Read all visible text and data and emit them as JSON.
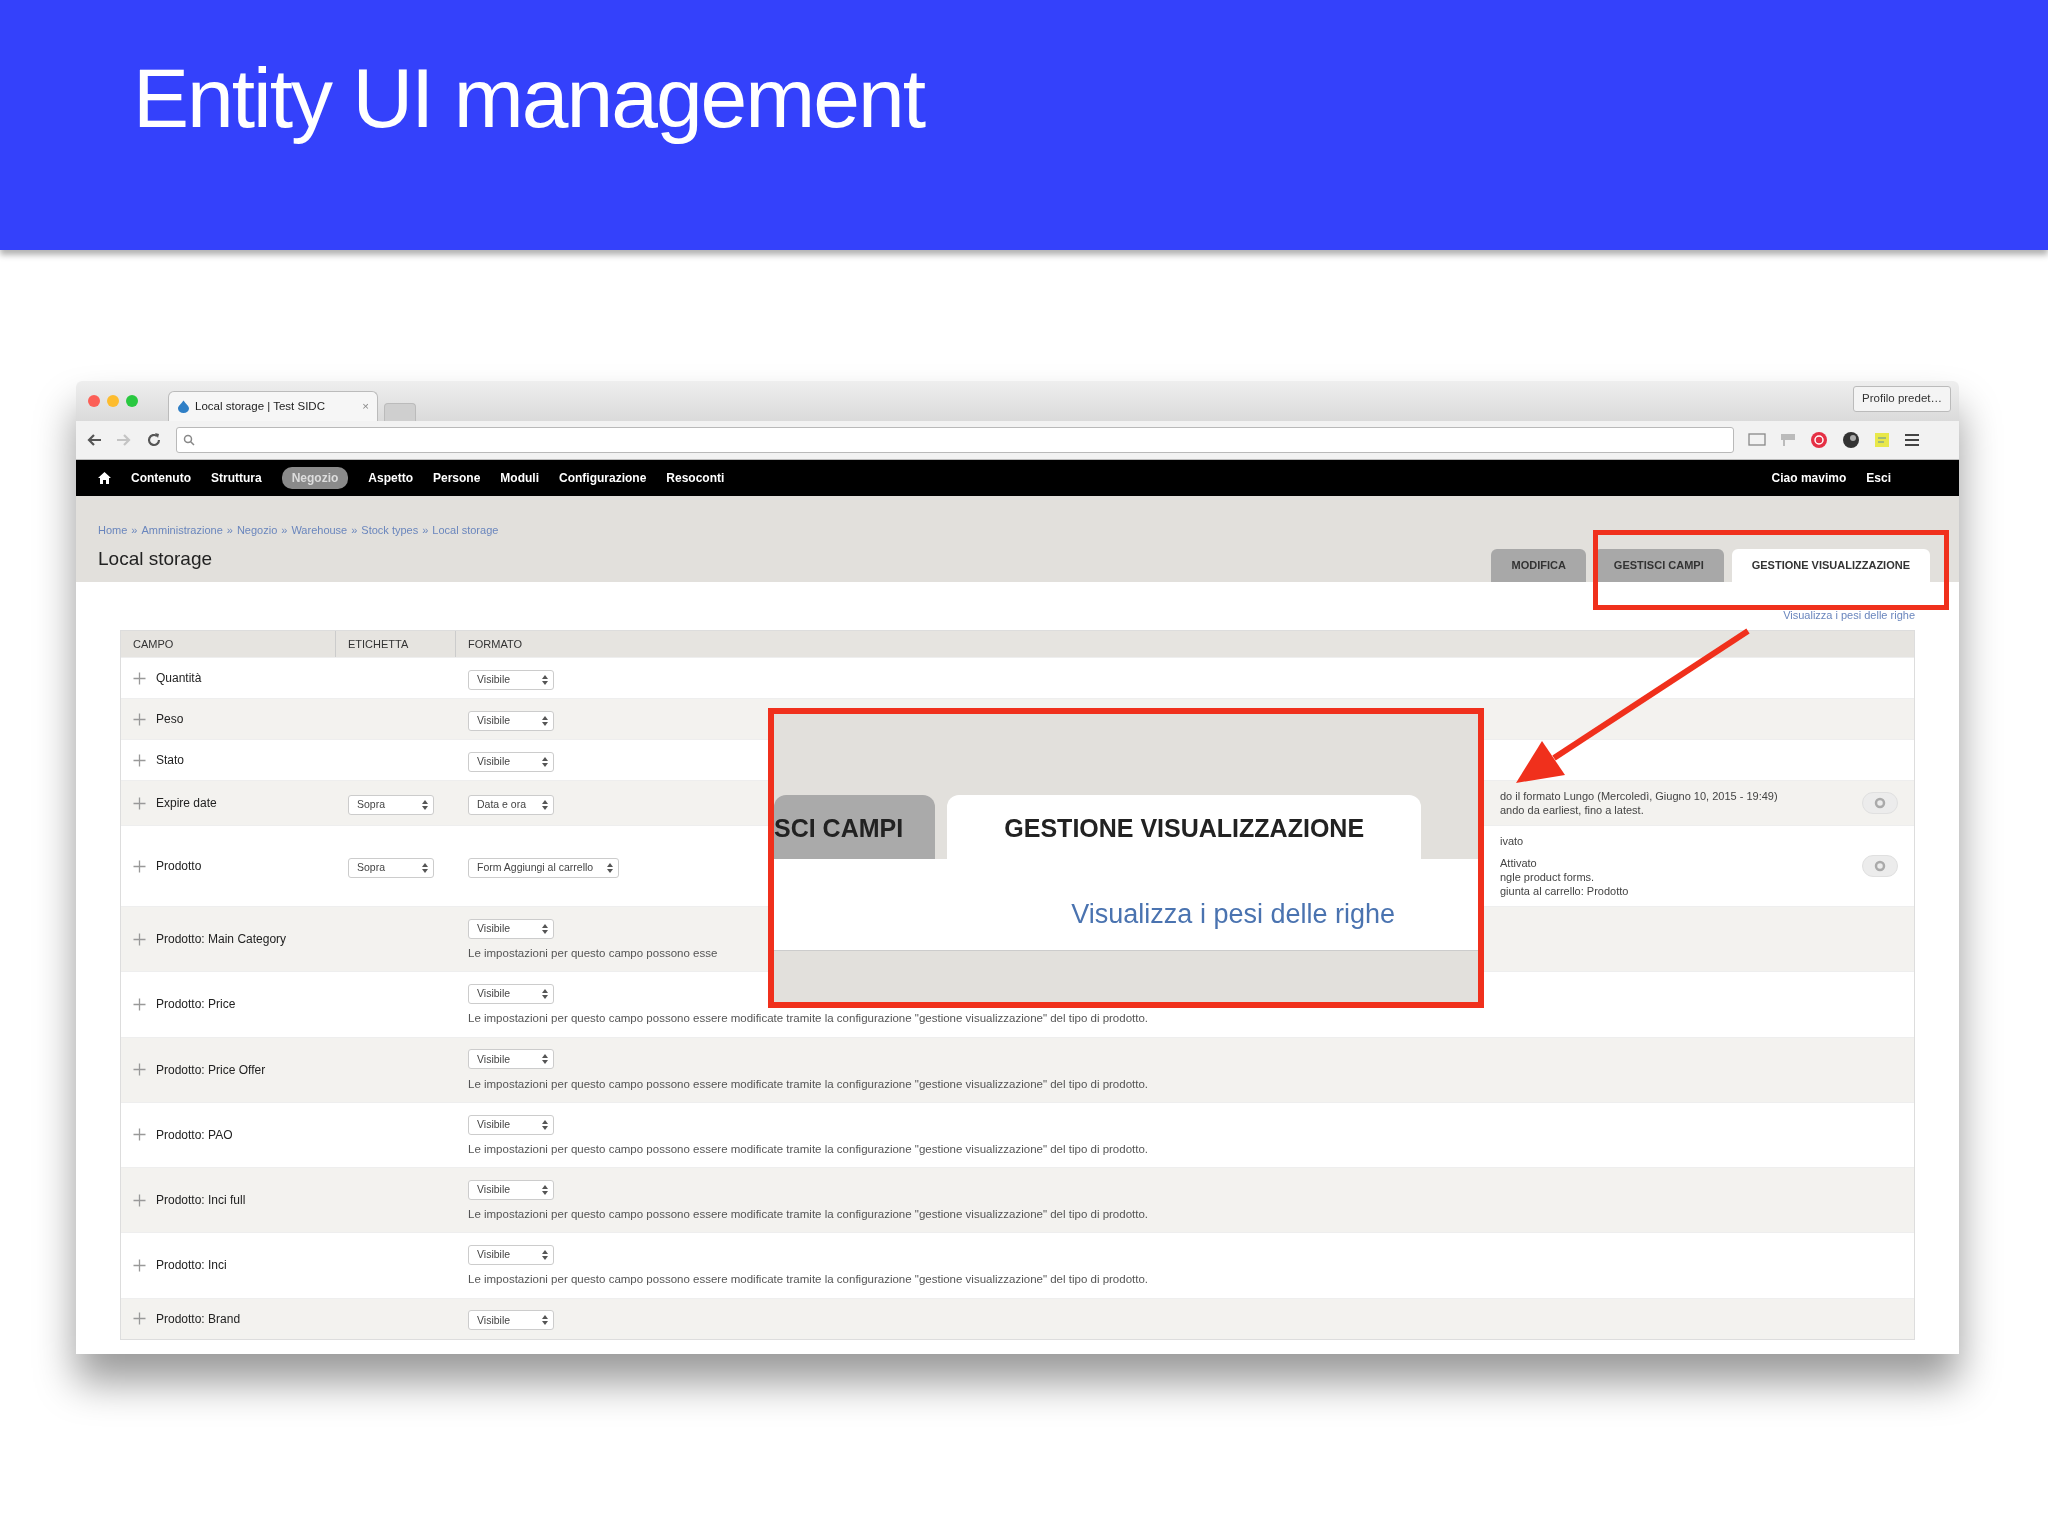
{
  "slide": {
    "title": "Entity UI management"
  },
  "browser": {
    "tab_title": "Local storage | Test SIDC",
    "tab_close": "×",
    "profile": "Profilo predet…"
  },
  "admin_menu": {
    "items": [
      {
        "label": "Contenuto",
        "selected": false
      },
      {
        "label": "Struttura",
        "selected": false
      },
      {
        "label": "Negozio",
        "selected": true
      },
      {
        "label": "Aspetto",
        "selected": false
      },
      {
        "label": "Persone",
        "selected": false
      },
      {
        "label": "Moduli",
        "selected": false
      },
      {
        "label": "Configurazione",
        "selected": false
      },
      {
        "label": "Resoconti",
        "selected": false
      }
    ],
    "greeting": "Ciao mavimo",
    "logout": "Esci"
  },
  "breadcrumb": [
    {
      "label": "Home",
      "separator": "»"
    },
    {
      "label": "Amministrazione",
      "separator": "»"
    },
    {
      "label": "Negozio",
      "separator": "»"
    },
    {
      "label": "Warehouse",
      "separator": "»"
    },
    {
      "label": "Stock types",
      "separator": "»"
    },
    {
      "label": "Local storage"
    }
  ],
  "page_title": "Local storage",
  "tabs": [
    {
      "label": "MODIFICA",
      "selected": false
    },
    {
      "label": "GESTISCI CAMPI",
      "selected": false
    },
    {
      "label": "GESTIONE VISUALIZZAZIONE",
      "selected": true
    }
  ],
  "row_weights_link": "Visualizza i pesi delle righe",
  "table": {
    "columns": [
      "CAMPO",
      "ETICHETTA",
      "FORMATO"
    ],
    "rows": [
      {
        "field": "Quantità",
        "format": "Visibile"
      },
      {
        "field": "Peso",
        "format": "Visibile"
      },
      {
        "field": "Stato",
        "format": "Visibile"
      },
      {
        "field": "Expire date",
        "label": "Sopra",
        "format": "Data e ora",
        "summary": [
          [
            "do il formato Lungo (Mercoledì, Giugno 10, 2015 - 19:49)",
            "ando da earliest, fino a latest."
          ]
        ]
      },
      {
        "field": "Prodotto",
        "label": "Sopra",
        "format": "Form Aggiungi al carrello",
        "summary": [
          [
            "ivato"
          ],
          [
            "Attivato",
            "ngle product forms.",
            "giunta al carrello: Prodotto"
          ]
        ]
      },
      {
        "field": "Prodotto: Main Category",
        "format": "Visibile",
        "note": {
          "text": "Le impostazioni per questo campo possono esse"
        }
      },
      {
        "field": "Prodotto: Price",
        "format": "Visibile",
        "note": {
          "text": "Le impostazioni per questo campo possono essere modificate tramite la",
          "link": "configurazione \"gestione visualizzazione\" del tipo di prodotto",
          "end": "."
        }
      },
      {
        "field": "Prodotto: Price Offer",
        "format": "Visibile",
        "note": {
          "text": "Le impostazioni per questo campo possono essere modificate tramite la",
          "link": "configurazione \"gestione visualizzazione\" del tipo di prodotto",
          "end": "."
        }
      },
      {
        "field": "Prodotto: PAO",
        "format": "Visibile",
        "note": {
          "text": "Le impostazioni per questo campo possono essere modificate tramite la",
          "link": "configurazione \"gestione visualizzazione\" del tipo di prodotto",
          "end": "."
        }
      },
      {
        "field": "Prodotto: Inci full",
        "format": "Visibile",
        "note": {
          "text": "Le impostazioni per questo campo possono essere modificate tramite la",
          "link": "configurazione \"gestione visualizzazione\" del tipo di prodotto",
          "end": "."
        }
      },
      {
        "field": "Prodotto: Inci",
        "format": "Visibile",
        "note": {
          "text": "Le impostazioni per questo campo possono essere modificate tramite la",
          "link": "configurazione \"gestione visualizzazione\" del tipo di prodotto",
          "end": "."
        }
      },
      {
        "field": "Prodotto: Brand",
        "format": "Visibile"
      }
    ]
  },
  "callout": {
    "tabs": [
      {
        "label": "SCI CAMPI",
        "selected": false
      },
      {
        "label": "GESTIONE VISUALIZZAZIONE",
        "selected": true
      }
    ],
    "link": "Visualizza i pesi delle righe"
  }
}
